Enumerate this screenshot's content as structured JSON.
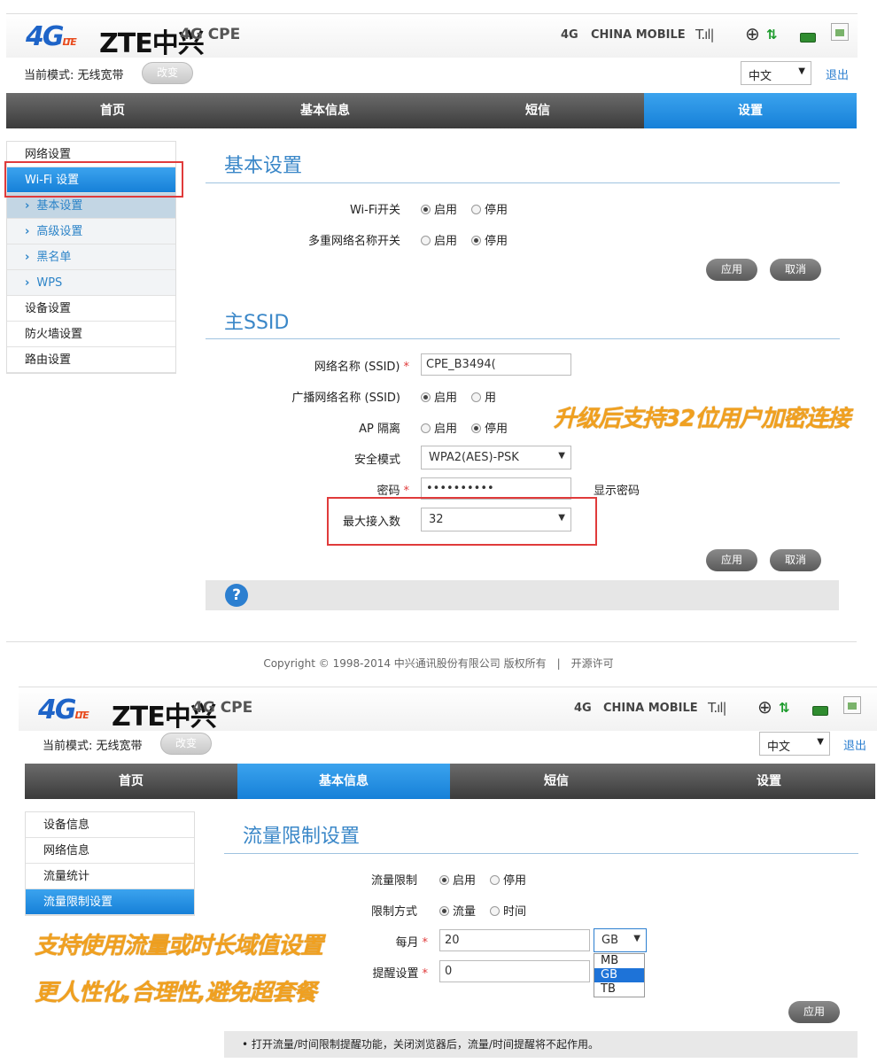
{
  "header": {
    "logo_4g": "4G",
    "logo_lte": "LTE",
    "brand": "ZTE中兴",
    "product": "4G CPE",
    "network": "4G",
    "carrier": "CHINA MOBILE",
    "signal_icon": "signal-bars-icon",
    "globe_icon": "globe-icon",
    "battery_icon": "battery-icon"
  },
  "mode": {
    "label": "当前模式: 无线宽带",
    "change": "改变"
  },
  "language": {
    "selected": "中文",
    "logout": "退出"
  },
  "nav": {
    "home": "首页",
    "basic_info": "基本信息",
    "sms": "短信",
    "settings": "设置"
  },
  "panel1": {
    "sidebar": {
      "network": "网络设置",
      "wifi": "Wi-Fi 设置",
      "sub": [
        "基本设置",
        "高级设置",
        "黑名单",
        "WPS"
      ],
      "device": "设备设置",
      "firewall": "防火墙设置",
      "router": "路由设置"
    },
    "basic": {
      "title": "基本设置",
      "wifi_switch": "Wi-Fi开关",
      "multi_ssid": "多重网络名称开关",
      "enable": "启用",
      "disable": "停用",
      "apply": "应用",
      "cancel": "取消"
    },
    "ssid": {
      "title": "主SSID",
      "name_label": "网络名称 (SSID)",
      "name_value": "CPE_B3494(",
      "broadcast_label": "广播网络名称 (SSID)",
      "broadcast_disable": "用",
      "ap_label": "AP 隔离",
      "ap_enable": "启用",
      "ap_disable": "停用",
      "security_label": "安全模式",
      "security_value": "WPA2(AES)-PSK",
      "password_label": "密码",
      "password_value": "••••••••••",
      "show_password": "显示密码",
      "max_label": "最大接入数",
      "max_value": "32",
      "apply": "应用",
      "cancel": "取消",
      "help": "?"
    },
    "annotation": "升级后支持32位用户加密连接",
    "copyright": "Copyright © 1998-2014 中兴通讯股份有限公司 版权所有　|　开源许可"
  },
  "panel2": {
    "sidebar": [
      "设备信息",
      "网络信息",
      "流量统计",
      "流量限制设置"
    ],
    "title": "流量限制设置",
    "limit_label": "流量限制",
    "enable": "启用",
    "disable": "停用",
    "method_label": "限制方式",
    "method_traffic": "流量",
    "method_time": "时间",
    "monthly_label": "每月",
    "monthly_value": "20",
    "unit_selected": "GB",
    "unit_options": [
      "MB",
      "GB",
      "TB"
    ],
    "remind_label": "提醒设置",
    "remind_value": "0",
    "apply": "应用",
    "note": "• 打开流量/时间限制提醒功能，关闭浏览器后，流量/时间提醒将不起作用。",
    "annotation1": "支持使用流量或时长域值设置",
    "annotation2": "更人性化,合理性,避免超套餐"
  },
  "colors": {
    "accent": "#1680d8",
    "annotation": "#f0a020",
    "highlight_box": "#e03b3b"
  }
}
